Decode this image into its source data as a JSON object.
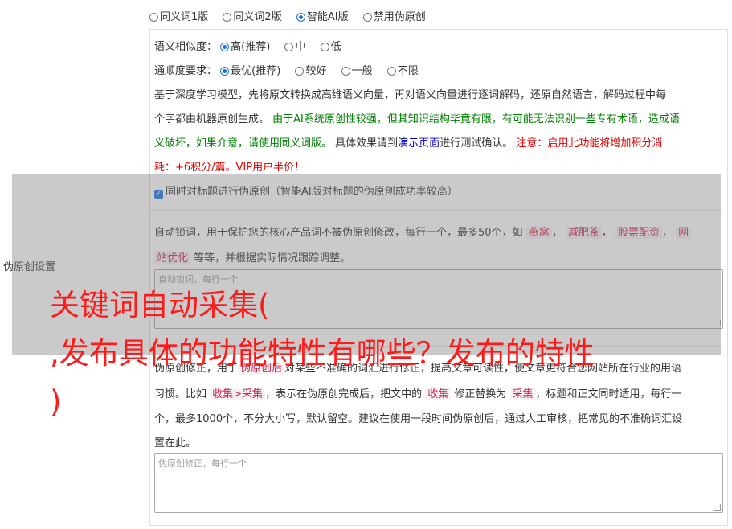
{
  "modes": {
    "options": [
      "同义词1版",
      "同义词2版",
      "智能AI版",
      "禁用伪原创"
    ],
    "selected_index": 2
  },
  "similarity": {
    "label": "语义相似度：",
    "options": [
      "高(推荐)",
      "中",
      "低"
    ],
    "selected_index": 0
  },
  "fluency": {
    "label": "通顺度要求：",
    "options": [
      "最优(推荐)",
      "较好",
      "一般",
      "不限"
    ],
    "selected_index": 0
  },
  "description": {
    "line1": "基于深度学习模型，先将原文转换成高维语义向量，再对语义向量进行逐词解码，还原自然语言，解码过程中每",
    "line2_black": "个字都由机器原创生成。",
    "line2_green": "由于AI系统原创性较强，但其知识结构毕竟有限，有可能无法识别一些专有术语，造成语",
    "line3_green": "义破坏，如果介意，请使用同义词版。",
    "line3_black1": "具体效果请到",
    "line3_link": "演示页面",
    "line3_black2": "进行测试确认。",
    "line3_red": "注意：启用此功能将增加积分消",
    "line4_red": "耗：+6积分/篇。VIP用户半价！"
  },
  "title_checkbox": {
    "checked": true,
    "label": "同时对标题进行伪原创（智能AI版对标题的伪原创成功率较高）"
  },
  "sidebar_label": "伪原创设置",
  "lock_words": {
    "text_pre": "自动锁词，用于保护您的核心产品词不被伪原创修改，每行一个，最多50个，如",
    "ex1": "燕窝",
    "ex2": "减肥茶",
    "ex3": "股票配资",
    "ex4_a": "网",
    "ex4_b": "站优化",
    "text_post": "等等，并根据实际情况跟踪调整。",
    "placeholder": "自动锁词，每行一个"
  },
  "correction": {
    "line1": "伪原创修正，用于",
    "chip_inline": "伪原创后",
    "line1_post": "对某些不准确的词汇进行修正，提高文章可读性，使文章更符合您网站所在行业的用语",
    "line2_pre": "习惯。比如",
    "ex_pair": "收集>采集",
    "line2_mid": "，表示在伪原创完成后，把文中的",
    "ex_from": "收集",
    "line2_mid2": "修正替换为",
    "ex_to": "采集",
    "line2_post": "，标题和正文同时适用，每行一",
    "line3": "个，最多1000个，不分大小写，默认留空。建议在使用一段时间伪原创后，通过人工审核，把常见的不准确词汇设",
    "line4": "置在此。",
    "placeholder": "伪原创修正，每行一个"
  },
  "overlay_title": {
    "line1": "关键词自动采集(",
    "line2": ",发布具体的功能特性有哪些？发布的特性",
    "line3": ")"
  },
  "colors": {
    "accent": "#1a73e8",
    "green_text": "#008000",
    "red_text": "#e00000",
    "link_text": "#0000cc",
    "chip_text": "#c7254e",
    "overlay_text": "#ff1a1a"
  }
}
